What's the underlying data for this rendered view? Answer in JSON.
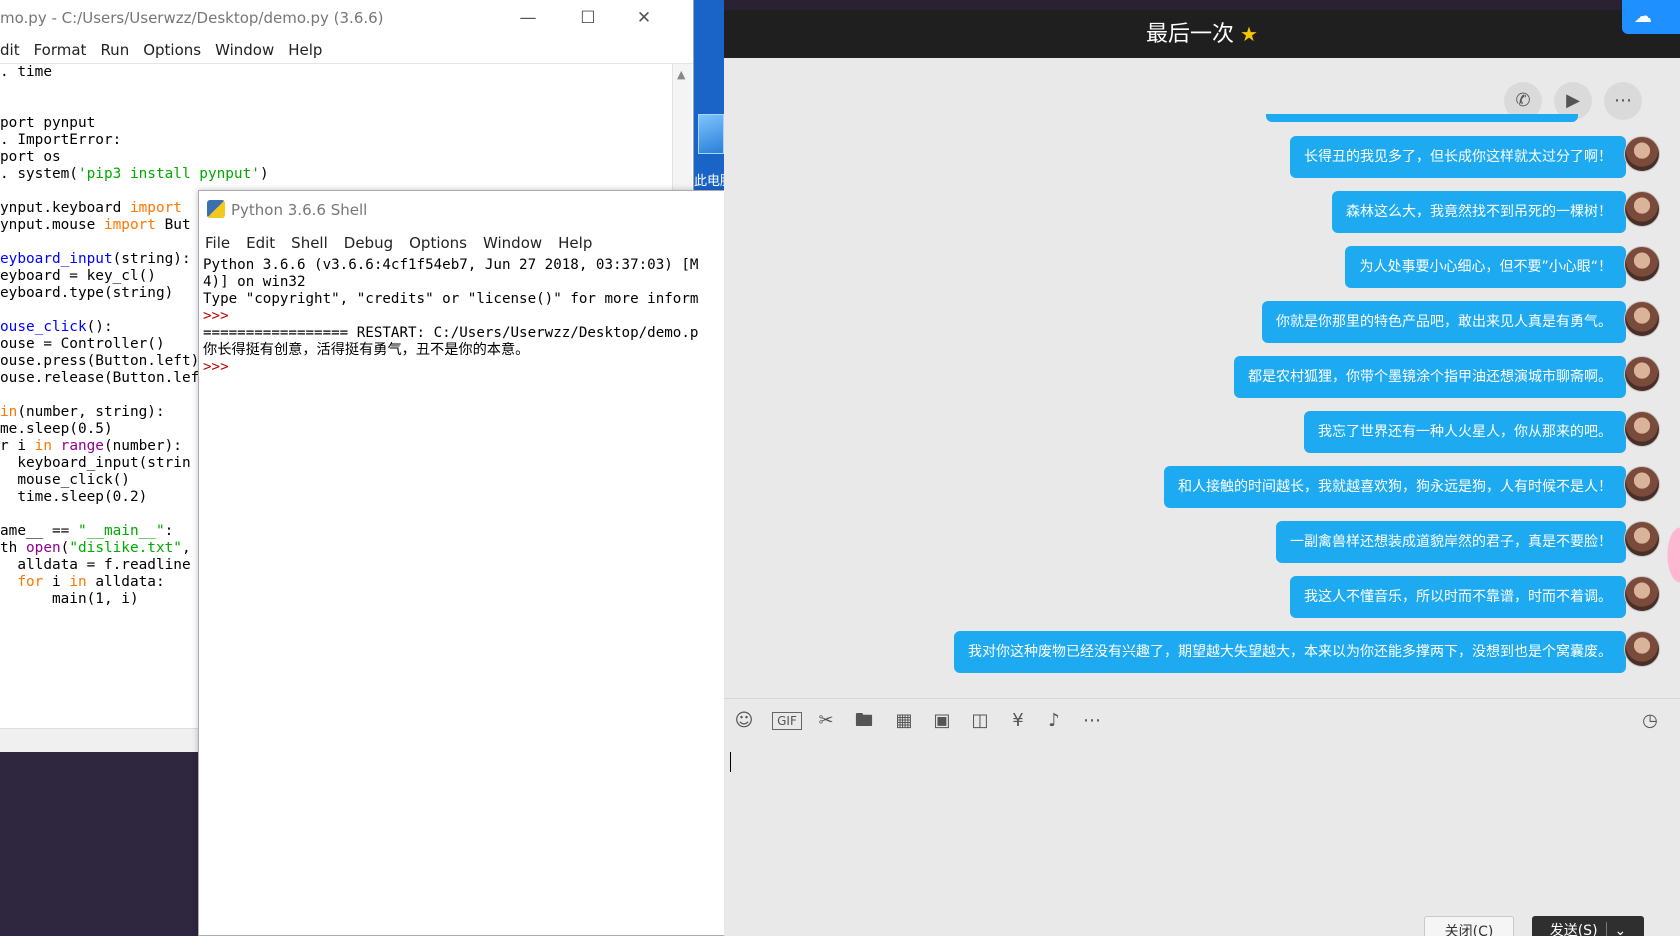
{
  "editor": {
    "title": "mo.py - C:/Users/Userwzz/Desktop/demo.py (3.6.6)",
    "menu": [
      "dit",
      "Format",
      "Run",
      "Options",
      "Window",
      "Help"
    ],
    "code_lines": [
      ". time",
      "",
      "",
      "port pynput",
      ". ImportError:",
      "port os",
      ". system('pip3 install pynput')",
      "",
      "ynput.keyboard import",
      "ynput.mouse import But",
      "",
      "eyboard_input(string):",
      "eyboard = key_cl()",
      "eyboard.type(string)",
      "",
      "ouse_click():",
      "ouse = Controller()",
      "ouse.press(Button.left)",
      "ouse.release(Button.lef",
      "",
      "in(number, string):",
      "me.sleep(0.5)",
      "r i in range(number):",
      "  keyboard_input(strin",
      "  mouse_click()",
      "  time.sleep(0.2)",
      "",
      "ame__ == \"__main__\":",
      "th open(\"dislike.txt\",",
      "  alldata = f.readline",
      "  for i in alldata:",
      "      main(1, i)"
    ]
  },
  "shell": {
    "title": "Python 3.6.6 Shell",
    "menu": [
      "File",
      "Edit",
      "Shell",
      "Debug",
      "Options",
      "Window",
      "Help"
    ],
    "banner1": "Python 3.6.6 (v3.6.6:4cf1f54eb7, Jun 27 2018, 03:37:03) [M",
    "banner2": "4)] on win32",
    "banner3": "Type \"copyright\", \"credits\" or \"license()\" for more inform",
    "prompt": ">>>",
    "restart": "================= RESTART: C:/Users/Userwzz/Desktop/demo.p",
    "output": "你长得挺有创意，活得挺有勇气，丑不是你的本意。",
    "prompt2": ">>>"
  },
  "desktop": {
    "icon_label": "此电脑"
  },
  "chat": {
    "title": "最后一次",
    "title_icon": "star-icon",
    "header_tools": [
      "phone-icon",
      "video-icon",
      "more-icon"
    ],
    "messages": [
      "长得丑的我见多了，但长成你这样就太过分了啊！",
      "森林这么大，我竟然找不到吊死的一棵树！",
      "为人处事要小心细心，但不要”小心眼“！",
      "你就是你那里的特色产品吧，敢出来见人真是有勇气。",
      "都是农村狐狸，你带个墨镜涂个指甲油还想演城市聊斋啊。",
      "我忘了世界还有一种人火星人，你从那来的吧。",
      "和人接触的时间越长，我就越喜欢狗，狗永远是狗，人有时候不是人！",
      "一副禽兽样还想装成道貌岸然的君子，真是不要脸！",
      "我这人不懂音乐，所以时而不靠谱，时而不着调。",
      "我对你这种废物已经没有兴趣了，期望越大失望越大，本来以为你还能多撑两下，没想到也是个窝囊废。"
    ],
    "toolbar": [
      "emoji-icon",
      "gif-icon",
      "scissors-icon",
      "folder-icon",
      "photo-album-icon",
      "image-icon",
      "shake-icon",
      "red-packet-icon",
      "music-icon",
      "more-icon"
    ],
    "close_label": "关闭(C)",
    "send_label": "发送(S)",
    "bubble_color": "#1eaaf1"
  }
}
